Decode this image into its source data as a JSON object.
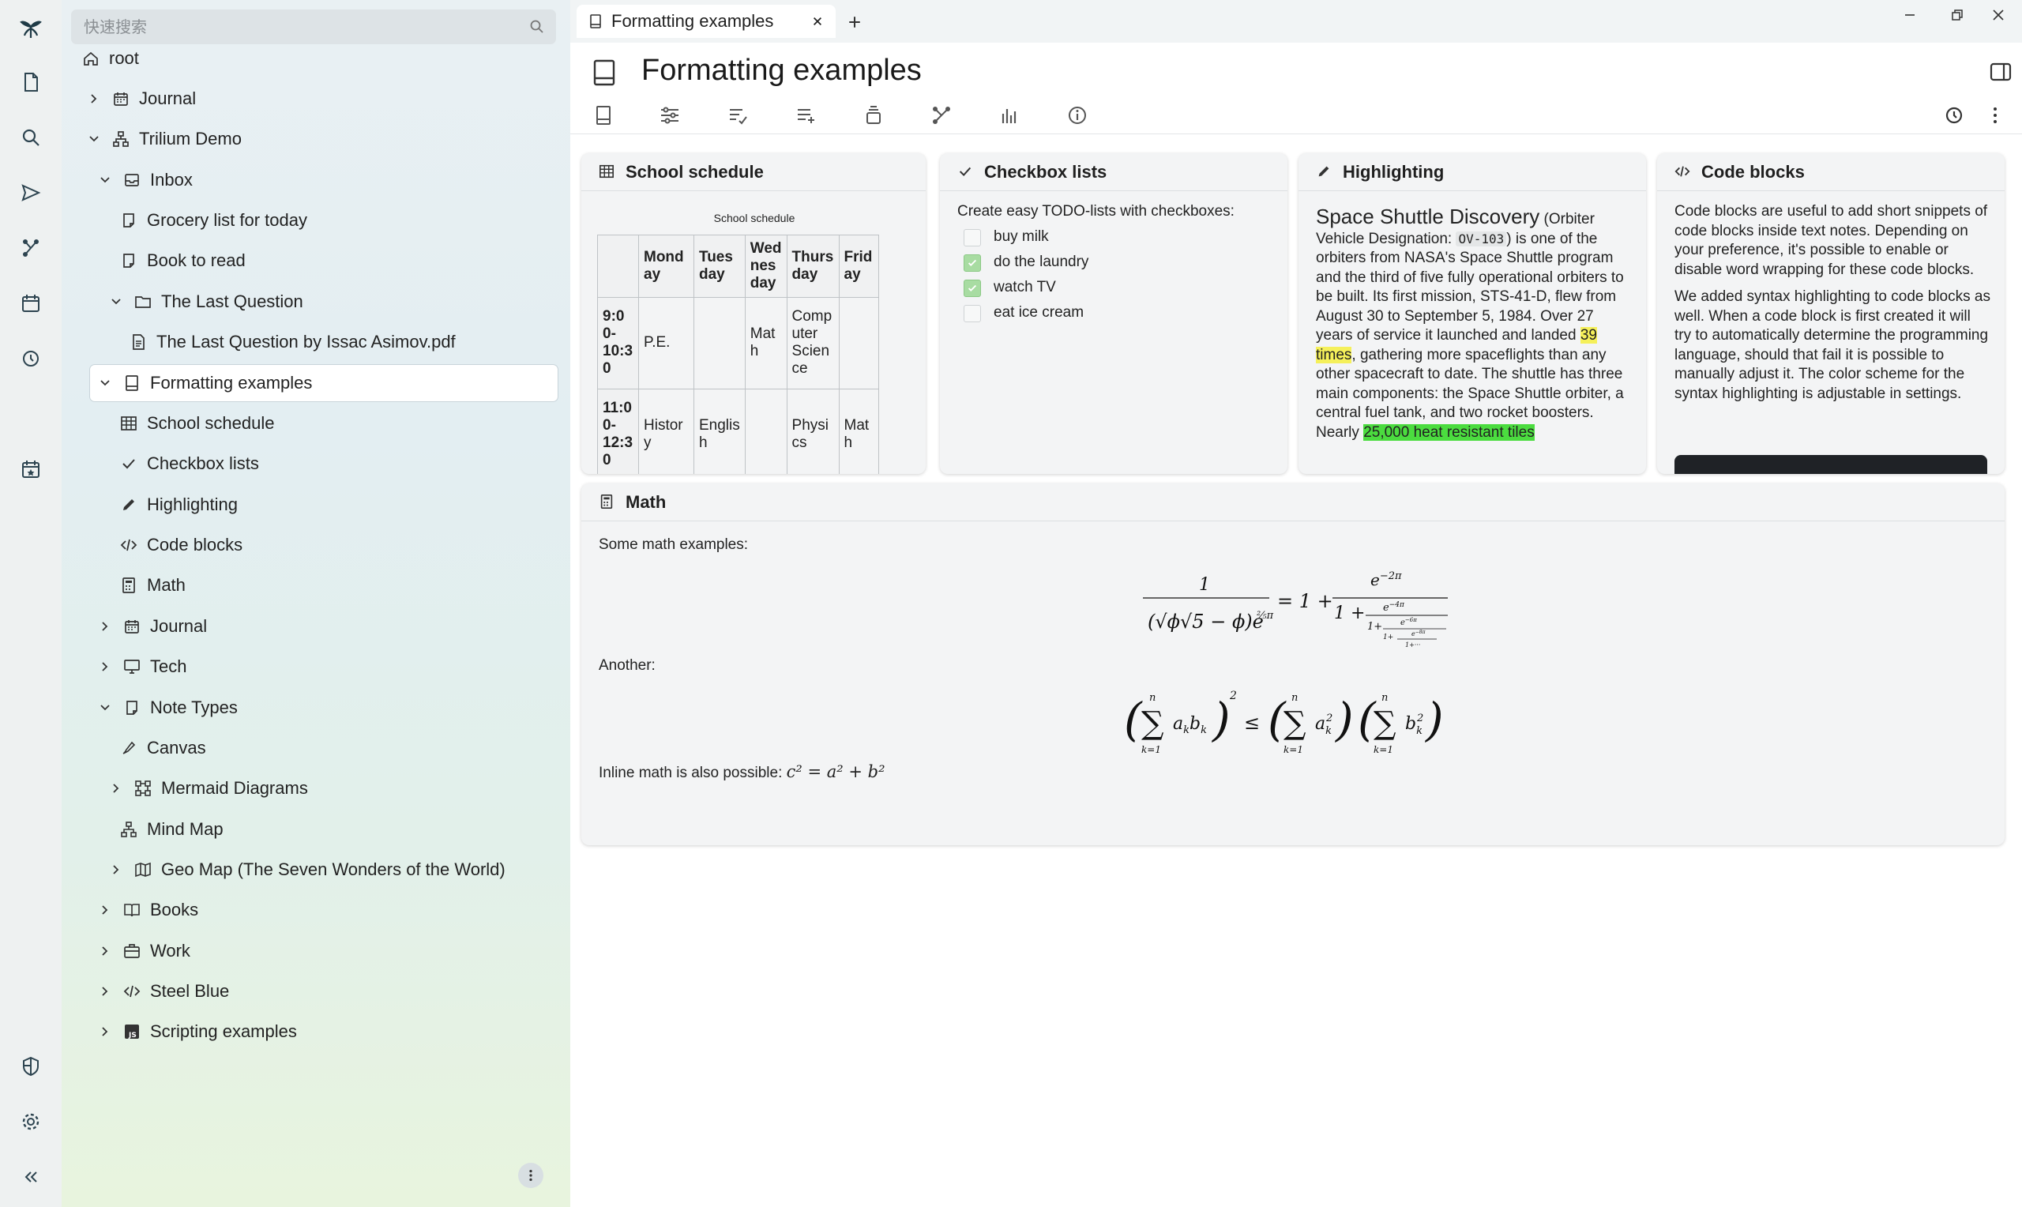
{
  "search": {
    "placeholder": "快速搜索"
  },
  "tree": [
    {
      "label": "root",
      "icon": "home-icon"
    },
    {
      "label": "Journal",
      "icon": "calendar-icon"
    },
    {
      "label": "Trilium Demo",
      "icon": "sitemap-icon"
    },
    {
      "label": "Inbox",
      "icon": "inbox-icon"
    },
    {
      "label": "Grocery list for today",
      "icon": "note-icon"
    },
    {
      "label": "Book to read",
      "icon": "note-icon"
    },
    {
      "label": "The Last Question",
      "icon": "folder-icon"
    },
    {
      "label": "The Last Question by Issac Asimov.pdf",
      "icon": "file-icon"
    },
    {
      "label": "Formatting examples",
      "icon": "book-icon"
    },
    {
      "label": "School schedule",
      "icon": "table-icon"
    },
    {
      "label": "Checkbox lists",
      "icon": "check-icon"
    },
    {
      "label": "Highlighting",
      "icon": "pencil-icon"
    },
    {
      "label": "Code blocks",
      "icon": "code-icon"
    },
    {
      "label": "Math",
      "icon": "calculator-icon"
    },
    {
      "label": "Journal",
      "icon": "calendar-icon"
    },
    {
      "label": "Tech",
      "icon": "desktop-icon"
    },
    {
      "label": "Note Types",
      "icon": "note-icon"
    },
    {
      "label": "Canvas",
      "icon": "pen-icon"
    },
    {
      "label": "Mermaid Diagrams",
      "icon": "diagram-icon"
    },
    {
      "label": "Mind Map",
      "icon": "mindmap-icon"
    },
    {
      "label": "Geo Map (The Seven Wonders of the World)",
      "icon": "map-icon"
    },
    {
      "label": "Books",
      "icon": "book-open-icon"
    },
    {
      "label": "Work",
      "icon": "briefcase-icon"
    },
    {
      "label": "Steel Blue",
      "icon": "code-icon"
    },
    {
      "label": "Scripting examples",
      "icon": "js-icon"
    }
  ],
  "tab": {
    "title": "Formatting examples"
  },
  "note": {
    "title": "Formatting examples"
  },
  "cards": {
    "school": {
      "title": "School schedule",
      "caption": "School schedule",
      "headers": [
        "",
        "Mond ay",
        "Tues day",
        "Wed nes day",
        "Thurs day",
        "Frid ay"
      ],
      "rows": [
        [
          "9:0 0- 10:3 0",
          "P.E.",
          "",
          "Mat h",
          "Comp uter Scien ce",
          ""
        ],
        [
          "11:0 0- 12:3 0",
          "Histor y",
          "Englis h",
          "",
          "Physi cs",
          "Mat h"
        ]
      ]
    },
    "checkbox": {
      "title": "Checkbox lists",
      "intro": "Create easy TODO-lists with checkboxes:",
      "items": [
        {
          "label": "buy milk",
          "checked": false
        },
        {
          "label": "do the laundry",
          "checked": true
        },
        {
          "label": "watch TV",
          "checked": true
        },
        {
          "label": "eat ice cream",
          "checked": false
        }
      ]
    },
    "highlight": {
      "title": "Highlighting",
      "heading": "Space Shuttle Discovery",
      "p1": " (Orbiter Vehicle Designation: ",
      "code": "OV-103",
      "p2": ") is one of the orbiters from NASA's Space Shuttle program and the third of five fully operational orbiters to be built. Its first mission, STS-41-D, flew from August 30 to September 5, 1984. Over 27 years of service it launched and landed ",
      "mark1": "39 times",
      "p3": ", gathering more spaceflights than any other spacecraft to date. The shuttle has three main components: the Space Shuttle orbiter, a central fuel tank, and two rocket boosters. Nearly ",
      "mark2": "25,000 heat resistant tiles"
    },
    "code": {
      "title": "Code blocks",
      "p1": "Code blocks are useful to add short snippets of code blocks inside text notes. Depending on your preference, it's possible to enable or disable word wrapping for these code blocks.",
      "p2": "We added syntax highlighting to code blocks as well. When a code block is first created it will try to automatically determine the programming language, should that fail it is possible to manually adjust it. The color scheme for the syntax highlighting is adjustable in settings."
    },
    "math": {
      "title": "Math",
      "intro": "Some math examples:",
      "another": "Another:",
      "inline_text": "Inline math is also possible: ",
      "inline_formula": "c² = a² + b²"
    }
  },
  "colors": {
    "accent": "#4a8fb5",
    "highlight_yellow": "#f5f05a",
    "highlight_green": "#4bdc3f"
  }
}
